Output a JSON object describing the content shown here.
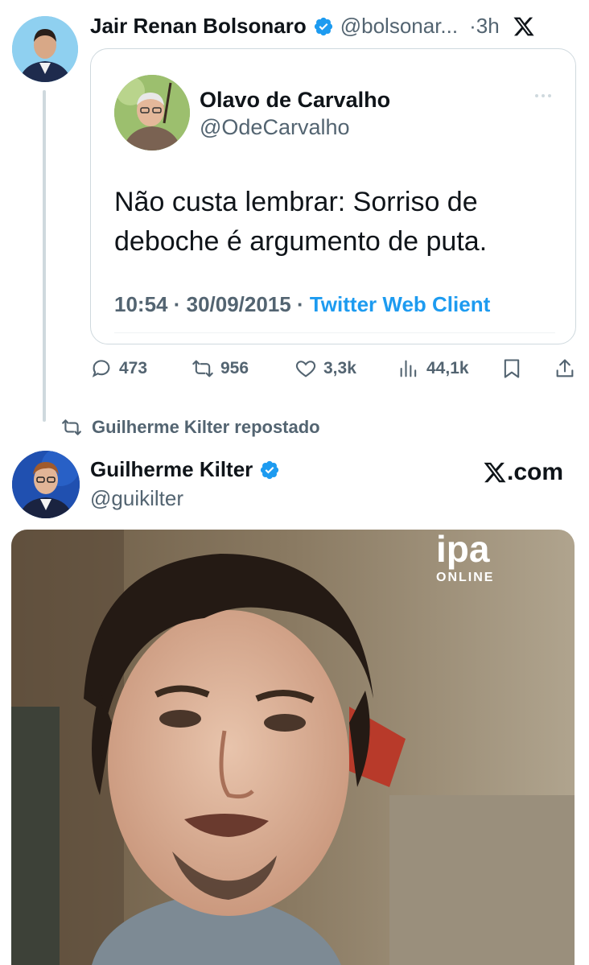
{
  "top_tweet": {
    "author_name": "Jair Renan Bolsonaro",
    "author_handle": "@bolsonar...",
    "separator_time": "·3h",
    "avatar_icon": "user-avatar-icon",
    "verified_icon": "verified-badge-icon",
    "platform_icon": "x-logo-icon",
    "quote": {
      "author_name": "Olavo de Carvalho",
      "author_handle": "@OdeCarvalho",
      "more_icon": "more-dots-icon",
      "text_line1": "Não custa lembrar: Sorriso de",
      "text_line2": "deboche é argumento de puta.",
      "time": "10:54",
      "dot1": " · ",
      "date": "30/09/2015",
      "dot2": " · ",
      "client": "Twitter Web Client"
    },
    "actions": {
      "replies": "473",
      "reposts": "956",
      "likes": "3,3k",
      "views": "44,1k"
    }
  },
  "repost_banner": {
    "text": "Guilherme Kilter repostado"
  },
  "second_tweet": {
    "author_name": "Guilherme Kilter",
    "author_handle": "@guikilter",
    "source_label": ".com",
    "media_watermark_top": "ipa",
    "media_watermark_bottom": "ONLINE"
  },
  "colors": {
    "text": "#0f1419",
    "secondary": "#536471",
    "accent": "#1d9bf0",
    "border": "#cfd9de"
  }
}
